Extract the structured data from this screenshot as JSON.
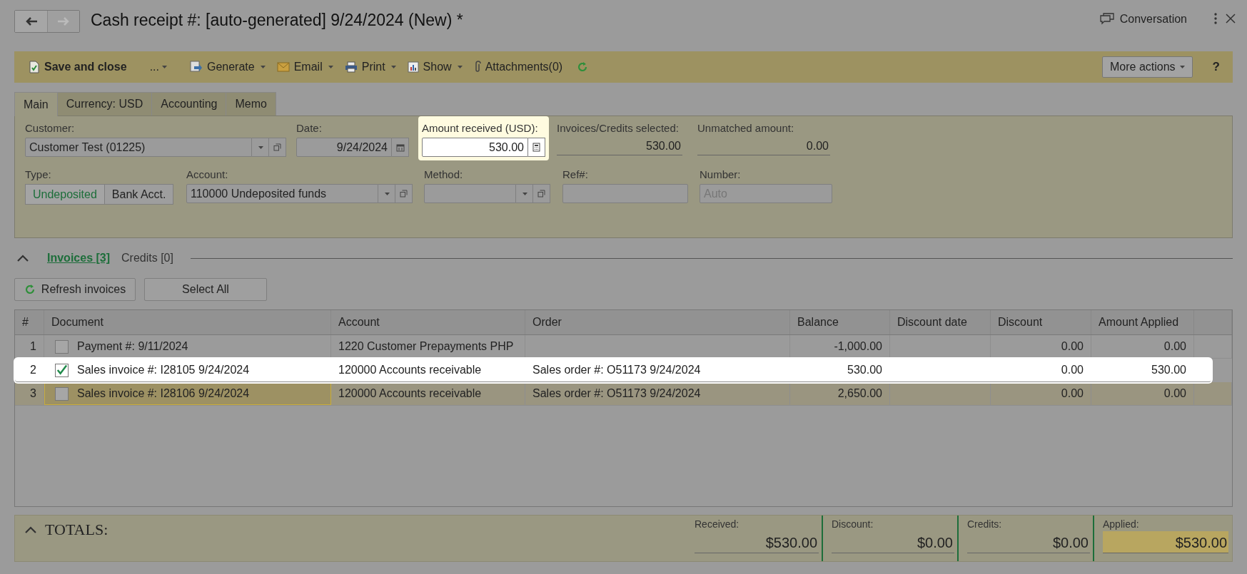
{
  "header": {
    "title": "Cash receipt #: [auto-generated] 9/24/2024 (New) *",
    "conversation": "Conversation"
  },
  "toolbar": {
    "items": [
      {
        "kind": "save",
        "label": "Save and close"
      },
      {
        "kind": "more",
        "label": "..."
      },
      {
        "kind": "generate",
        "label": "Generate"
      },
      {
        "kind": "email",
        "label": "Email"
      },
      {
        "kind": "print",
        "label": "Print"
      },
      {
        "kind": "show",
        "label": "Show"
      },
      {
        "kind": "attach",
        "label": "Attachments(0)"
      },
      {
        "kind": "refresh"
      }
    ],
    "more_actions": "More actions",
    "help": "?"
  },
  "tabs": [
    {
      "label": "Main",
      "selected": true
    },
    {
      "label": "Currency: USD",
      "selected": false
    },
    {
      "label": "Accounting",
      "selected": false
    },
    {
      "label": "Memo",
      "selected": false
    }
  ],
  "fields": [
    [
      {
        "kind": "select",
        "label": "Customer:",
        "value": "Customer Test (01225)",
        "highlighted": false
      },
      {
        "kind": "date",
        "label": "Date:",
        "value": "9/24/2024",
        "highlighted": false
      },
      {
        "kind": "number",
        "label": "Amount received (USD):",
        "value": "530.00",
        "highlighted": true
      },
      {
        "kind": "readonly",
        "label": "Invoices/Credits selected:",
        "value": "530.00",
        "highlighted": false
      },
      {
        "kind": "readonly",
        "label": "Unmatched amount:",
        "value": "0.00",
        "highlighted": false
      }
    ],
    [
      {
        "kind": "toggle",
        "label": "Type:",
        "options": [
          {
            "label": "Undeposited",
            "selected": true
          },
          {
            "label": "Bank Acct.",
            "selected": false
          }
        ]
      },
      {
        "kind": "select",
        "label": "Account:",
        "value": "110000 Undeposited funds",
        "highlighted": false
      },
      {
        "kind": "select",
        "label": "Method:",
        "highlighted": false
      },
      {
        "kind": "text",
        "label": "Ref#:",
        "highlighted": false
      },
      {
        "kind": "text",
        "label": "Number:",
        "placeholder": "Auto",
        "highlighted": false
      }
    ]
  ],
  "section": {
    "expanded": true,
    "tabs": [
      {
        "label": "Invoices [3]",
        "selected": true
      },
      {
        "label": "Credits [0]",
        "selected": false
      }
    ],
    "buttons": [
      {
        "kind": "refresh",
        "label": "Refresh invoices"
      },
      {
        "kind": "plain",
        "label": "Select All"
      }
    ]
  },
  "table": {
    "columns": [
      "#",
      "Document",
      "Account",
      "Order",
      "Balance",
      "Discount date",
      "Discount",
      "Amount Applied"
    ],
    "rows": [
      {
        "cells": [
          "1",
          "Payment #:  9/11/2024",
          "1220 Customer Prepayments PHP",
          "",
          "-1,000.00",
          "",
          "0.00",
          "0.00"
        ],
        "checked": false,
        "highlighted": false,
        "selected": false
      },
      {
        "cells": [
          "2",
          "Sales invoice #: I28105 9/24/2024",
          "120000 Accounts receivable",
          "Sales order #: O51173 9/24/2024",
          "530.00",
          "",
          "0.00",
          "530.00"
        ],
        "checked": true,
        "highlighted": true,
        "selected": false
      },
      {
        "cells": [
          "3",
          "Sales invoice #: I28106 9/24/2024",
          "120000 Accounts receivable",
          "Sales order #: O51173 9/24/2024",
          "2,650.00",
          "",
          "0.00",
          "0.00"
        ],
        "checked": false,
        "highlighted": false,
        "selected": true
      }
    ]
  },
  "totals": {
    "expanded": true,
    "title": "TOTALS:",
    "items": [
      {
        "label": "Received:",
        "value": "$530.00",
        "highlighted": false
      },
      {
        "label": "Discount:",
        "value": "$0.00",
        "highlighted": false
      },
      {
        "label": "Credits:",
        "value": "$0.00",
        "highlighted": false
      },
      {
        "label": "Applied:",
        "value": "$530.00",
        "highlighted": true
      }
    ]
  }
}
